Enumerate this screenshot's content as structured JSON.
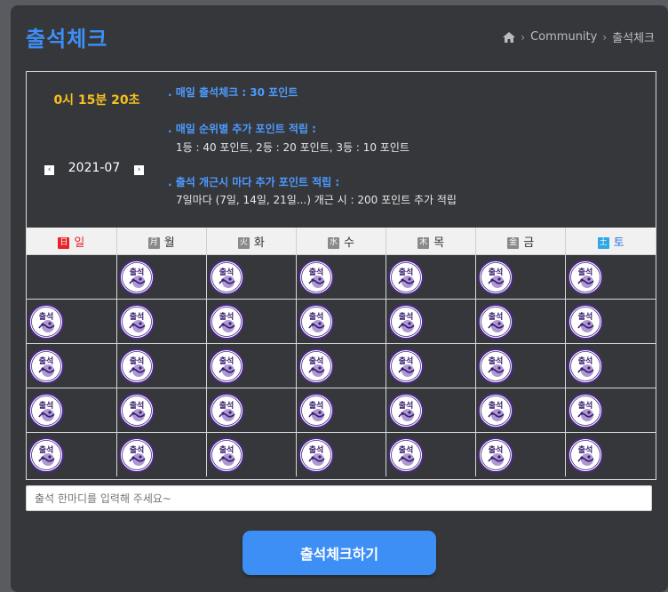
{
  "page": {
    "title": "출석체크",
    "breadcrumb": {
      "home_icon": "home-icon",
      "items": [
        "Community",
        "출석체크"
      ]
    }
  },
  "timer": "0시 15분 20초",
  "month_nav": {
    "label": "2021-07",
    "prev_glyph": "‹",
    "next_glyph": "›"
  },
  "info": {
    "daily": ". 매일 출석체크 : 30 포인트",
    "rank_title": ". 매일 순위별 추가 포인트 적립 :",
    "rank_detail": "1등 : 40 포인트,  2등 : 20 포인트,  3등 : 10 포인트",
    "streak_title": ". 출석 개근시 마다 추가 포인트 적립 :",
    "streak_detail": "7일마다 (7일, 14일, 21일...) 개근 시 : 200 포인트 추가 적립"
  },
  "calendar": {
    "weekdays": [
      {
        "hanja": "日",
        "label": "일",
        "chip_color": "#e8242a",
        "text_color": "#e8242a"
      },
      {
        "hanja": "月",
        "label": "월",
        "chip_color": "#8a8a8a",
        "text_color": "#333333"
      },
      {
        "hanja": "火",
        "label": "화",
        "chip_color": "#8a8a8a",
        "text_color": "#333333"
      },
      {
        "hanja": "水",
        "label": "수",
        "chip_color": "#8a8a8a",
        "text_color": "#333333"
      },
      {
        "hanja": "木",
        "label": "목",
        "chip_color": "#8a8a8a",
        "text_color": "#333333"
      },
      {
        "hanja": "金",
        "label": "금",
        "chip_color": "#8a8a8a",
        "text_color": "#333333"
      },
      {
        "hanja": "土",
        "label": "토",
        "chip_color": "#2da7e6",
        "text_color": "#2d6fe6"
      }
    ],
    "stamp_text": "출석",
    "weeks": [
      [
        false,
        true,
        true,
        true,
        true,
        true,
        true
      ],
      [
        true,
        true,
        true,
        true,
        true,
        true,
        true
      ],
      [
        true,
        true,
        true,
        true,
        true,
        true,
        true
      ],
      [
        true,
        true,
        true,
        true,
        true,
        true,
        true
      ],
      [
        true,
        true,
        true,
        true,
        true,
        true,
        true
      ]
    ]
  },
  "comment": {
    "placeholder": "출석 한마디를 입력해 주세요~"
  },
  "submit_label": "출석체크하기"
}
